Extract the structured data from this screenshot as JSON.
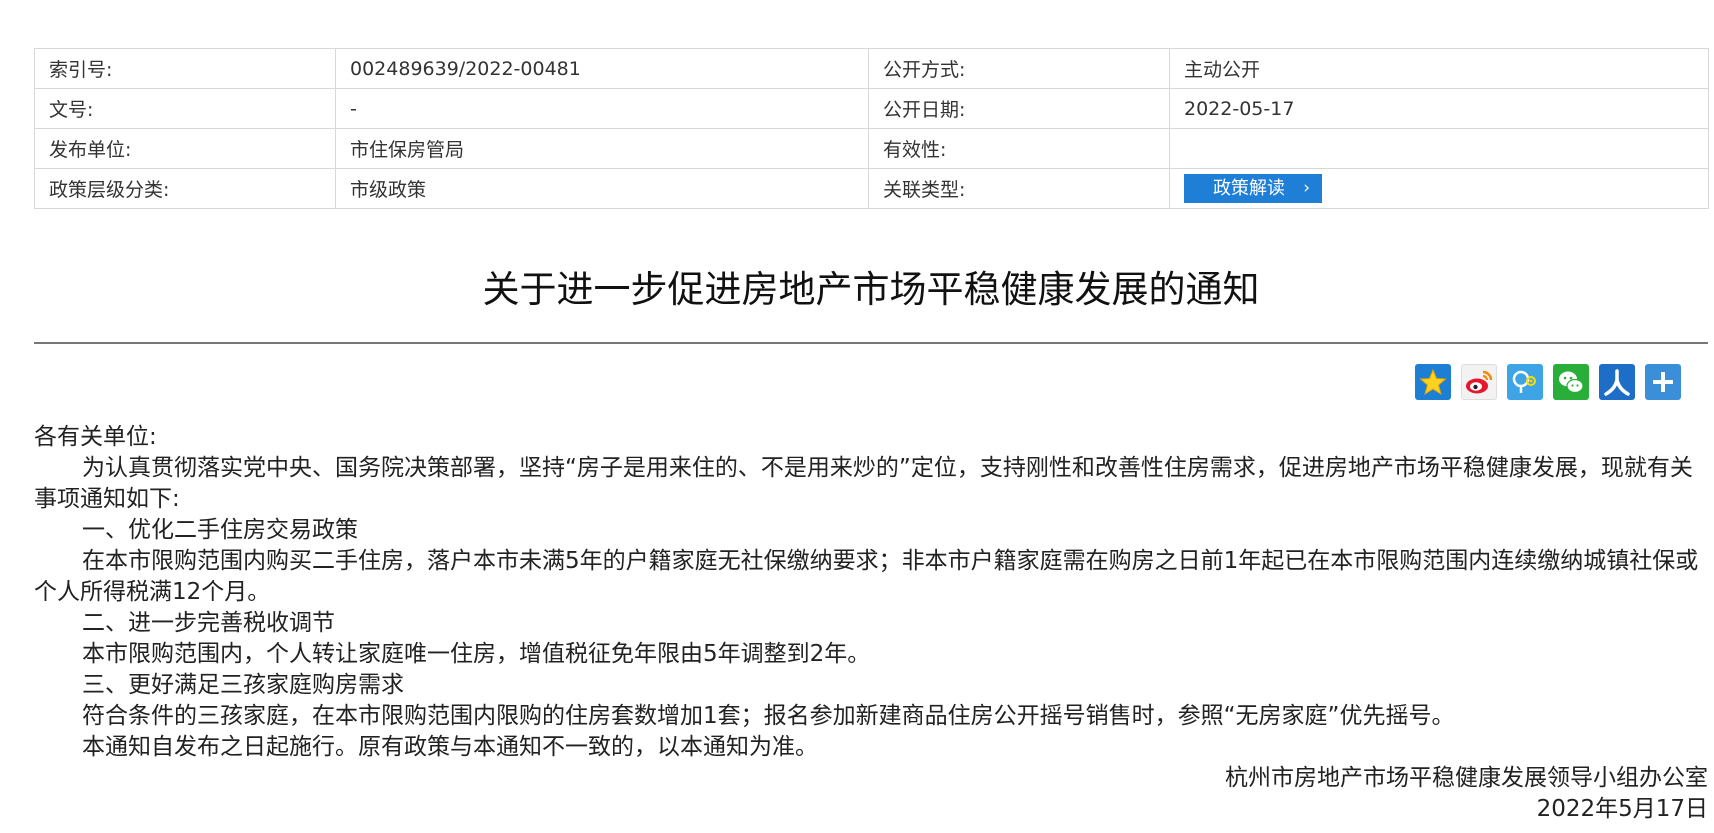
{
  "meta": {
    "index_label": "索引号:",
    "index_value": "002489639/2022-00481",
    "disclosure_label": "公开方式:",
    "disclosure_value": "主动公开",
    "docno_label": "文号:",
    "docno_value": "-",
    "date_label": "公开日期:",
    "date_value": "2022-05-17",
    "publisher_label": "发布单位:",
    "publisher_value": "市住保房管局",
    "validity_label": "有效性:",
    "validity_value": "",
    "level_label": "政策层级分类:",
    "level_value": "市级政策",
    "relation_label": "关联类型:",
    "relation_button": "政策解读",
    "relation_chevron": "›"
  },
  "title": "关于进一步促进房地产市场平稳健康发展的通知",
  "share": {
    "accent": "#1f7fd6",
    "icons": [
      "favorite-star-icon",
      "weibo-icon",
      "qzone-icon",
      "wechat-icon",
      "renren-icon",
      "more-plus-icon"
    ]
  },
  "body": {
    "salutation": "各有关单位:",
    "intro": "为认真贯彻落实党中央、国务院决策部署，坚持“房子是用来住的、不是用来炒的”定位，支持刚性和改善性住房需求，促进房地产市场平稳健康发展，现就有关事项通知如下:",
    "section1_title": "一、优化二手住房交易政策",
    "section1_text": "在本市限购范围内购买二手住房，落户本市未满5年的户籍家庭无社保缴纳要求；非本市户籍家庭需在购房之日前1年起已在本市限购范围内连续缴纳城镇社保或个人所得税满12个月。",
    "section2_title": "二、进一步完善税收调节",
    "section2_text": "本市限购范围内，个人转让家庭唯一住房，增值税征免年限由5年调整到2年。",
    "section3_title": "三、更好满足三孩家庭购房需求",
    "section3_text": "符合条件的三孩家庭，在本市限购范围内限购的住房套数增加1套；报名参加新建商品住房公开摇号销售时，参照“无房家庭”优先摇号。",
    "closing": "本通知自发布之日起施行。原有政策与本通知不一致的，以本通知为准。",
    "signature": "杭州市房地产市场平稳健康发展领导小组办公室",
    "sign_date": "2022年5月17日"
  }
}
